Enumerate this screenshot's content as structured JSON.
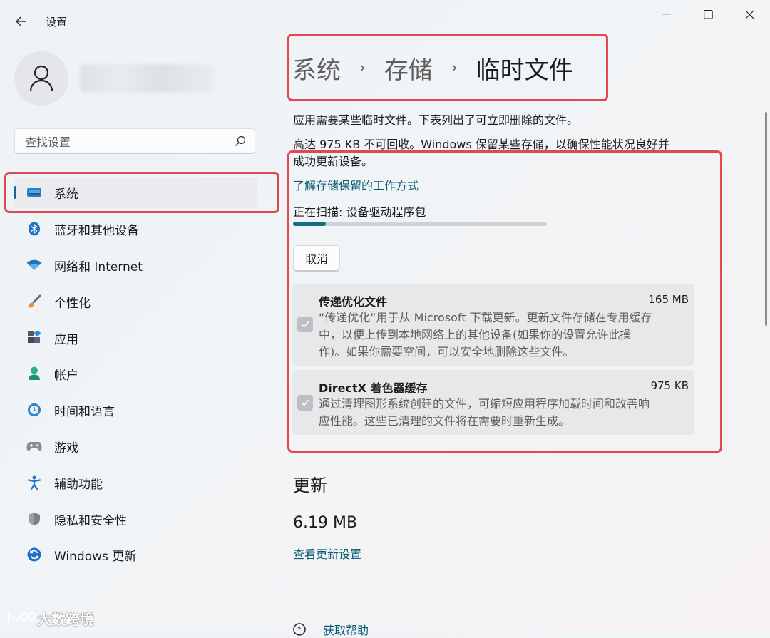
{
  "window": {
    "title": "设置",
    "back_icon": "back-arrow-icon",
    "controls": [
      "minimize-icon",
      "maximize-icon",
      "close-icon"
    ]
  },
  "sidebar": {
    "search_placeholder": "查找设置",
    "items": [
      {
        "label": "系统",
        "icon": "system-display-icon",
        "active": true
      },
      {
        "label": "蓝牙和其他设备",
        "icon": "bluetooth-icon"
      },
      {
        "label": "网络和 Internet",
        "icon": "wifi-icon"
      },
      {
        "label": "个性化",
        "icon": "paintbrush-icon"
      },
      {
        "label": "应用",
        "icon": "apps-icon"
      },
      {
        "label": "帐户",
        "icon": "account-icon"
      },
      {
        "label": "时间和语言",
        "icon": "time-language-icon"
      },
      {
        "label": "游戏",
        "icon": "gamepad-icon"
      },
      {
        "label": "辅助功能",
        "icon": "accessibility-icon"
      },
      {
        "label": "隐私和安全性",
        "icon": "shield-icon"
      },
      {
        "label": "Windows 更新",
        "icon": "windows-update-icon"
      }
    ]
  },
  "breadcrumb": {
    "items": [
      "系统",
      "存储"
    ],
    "separator": "›",
    "current": "临时文件"
  },
  "intro": {
    "line1": "应用需要某些临时文件。下表列出了可立即删除的文件。",
    "line2a": "高达 975 KB 不可回收。Windows 保留某些存储，以确保性能状况良好并",
    "line2b": "成功更新设备。",
    "learn_link": "了解存储保留的工作方式"
  },
  "scan": {
    "status": "正在扫描: 设备驱动程序包",
    "progress_fraction": 0.13,
    "cancel_label": "取消"
  },
  "items": [
    {
      "title": "传递优化文件",
      "size": "165 MB",
      "checked": true,
      "desc": [
        "“传递优化”用于从 Microsoft 下载更新。更新文件存储在专用缓存",
        "中，以便上传到本地网络上的其他设备(如果你的设置允许此操",
        "作)。如果你需要空间，可以安全地删除这些文件。"
      ]
    },
    {
      "title": "DirectX 着色器缓存",
      "size": "975 KB",
      "checked": true,
      "desc": [
        "通过清理图形系统创建的文件，可缩短应用程序加载时间和改善响",
        "应性能。这些已清理的文件将在需要时重新生成。"
      ]
    }
  ],
  "updates_section": {
    "title": "更新",
    "size": "6.19 MB",
    "link": "查看更新设置"
  },
  "help_link": "获取帮助",
  "watermark": "大数跨境",
  "colors": {
    "accent": "#0b6e88",
    "progress": "#0e7283",
    "highlight_box": "#e3484f",
    "link": "#0b5a74"
  }
}
